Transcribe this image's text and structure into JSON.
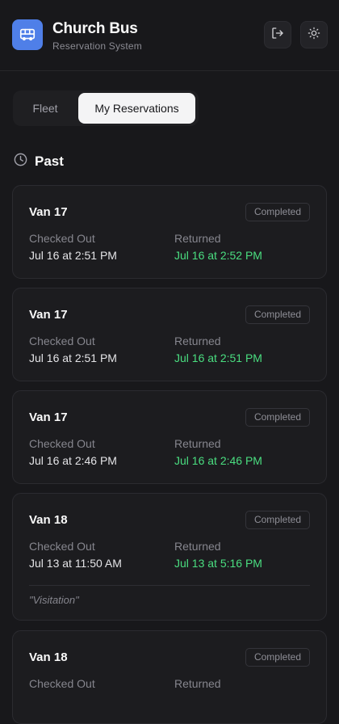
{
  "app": {
    "title": "Church Bus",
    "subtitle": "Reservation System",
    "logo_icon": "bus-icon",
    "accent": "#4f7fe8"
  },
  "header_actions": [
    {
      "icon": "logout-icon"
    },
    {
      "icon": "sun-icon"
    }
  ],
  "tabs": [
    {
      "label": "Fleet",
      "selected": false
    },
    {
      "label": "My Reservations",
      "selected": true
    }
  ],
  "section": {
    "icon": "clock-icon",
    "label": "Past"
  },
  "labels": {
    "checked_out": "Checked Out",
    "returned": "Returned"
  },
  "reservations": [
    {
      "vehicle": "Van 17",
      "status": "Completed",
      "checked_out": "Jul 16 at 2:51 PM",
      "returned": "Jul 16 at 2:52 PM",
      "note": ""
    },
    {
      "vehicle": "Van 17",
      "status": "Completed",
      "checked_out": "Jul 16 at 2:51 PM",
      "returned": "Jul 16 at 2:51 PM",
      "note": ""
    },
    {
      "vehicle": "Van 17",
      "status": "Completed",
      "checked_out": "Jul 16 at 2:46 PM",
      "returned": "Jul 16 at 2:46 PM",
      "note": ""
    },
    {
      "vehicle": "Van 18",
      "status": "Completed",
      "checked_out": "Jul 13 at 11:50 AM",
      "returned": "Jul 13 at 5:16 PM",
      "note": "\"Visitation\""
    },
    {
      "vehicle": "Van 18",
      "status": "Completed",
      "checked_out": "",
      "returned": "",
      "note": ""
    }
  ],
  "colors": {
    "background": "#18181b",
    "returned_text": "#4ade80"
  }
}
